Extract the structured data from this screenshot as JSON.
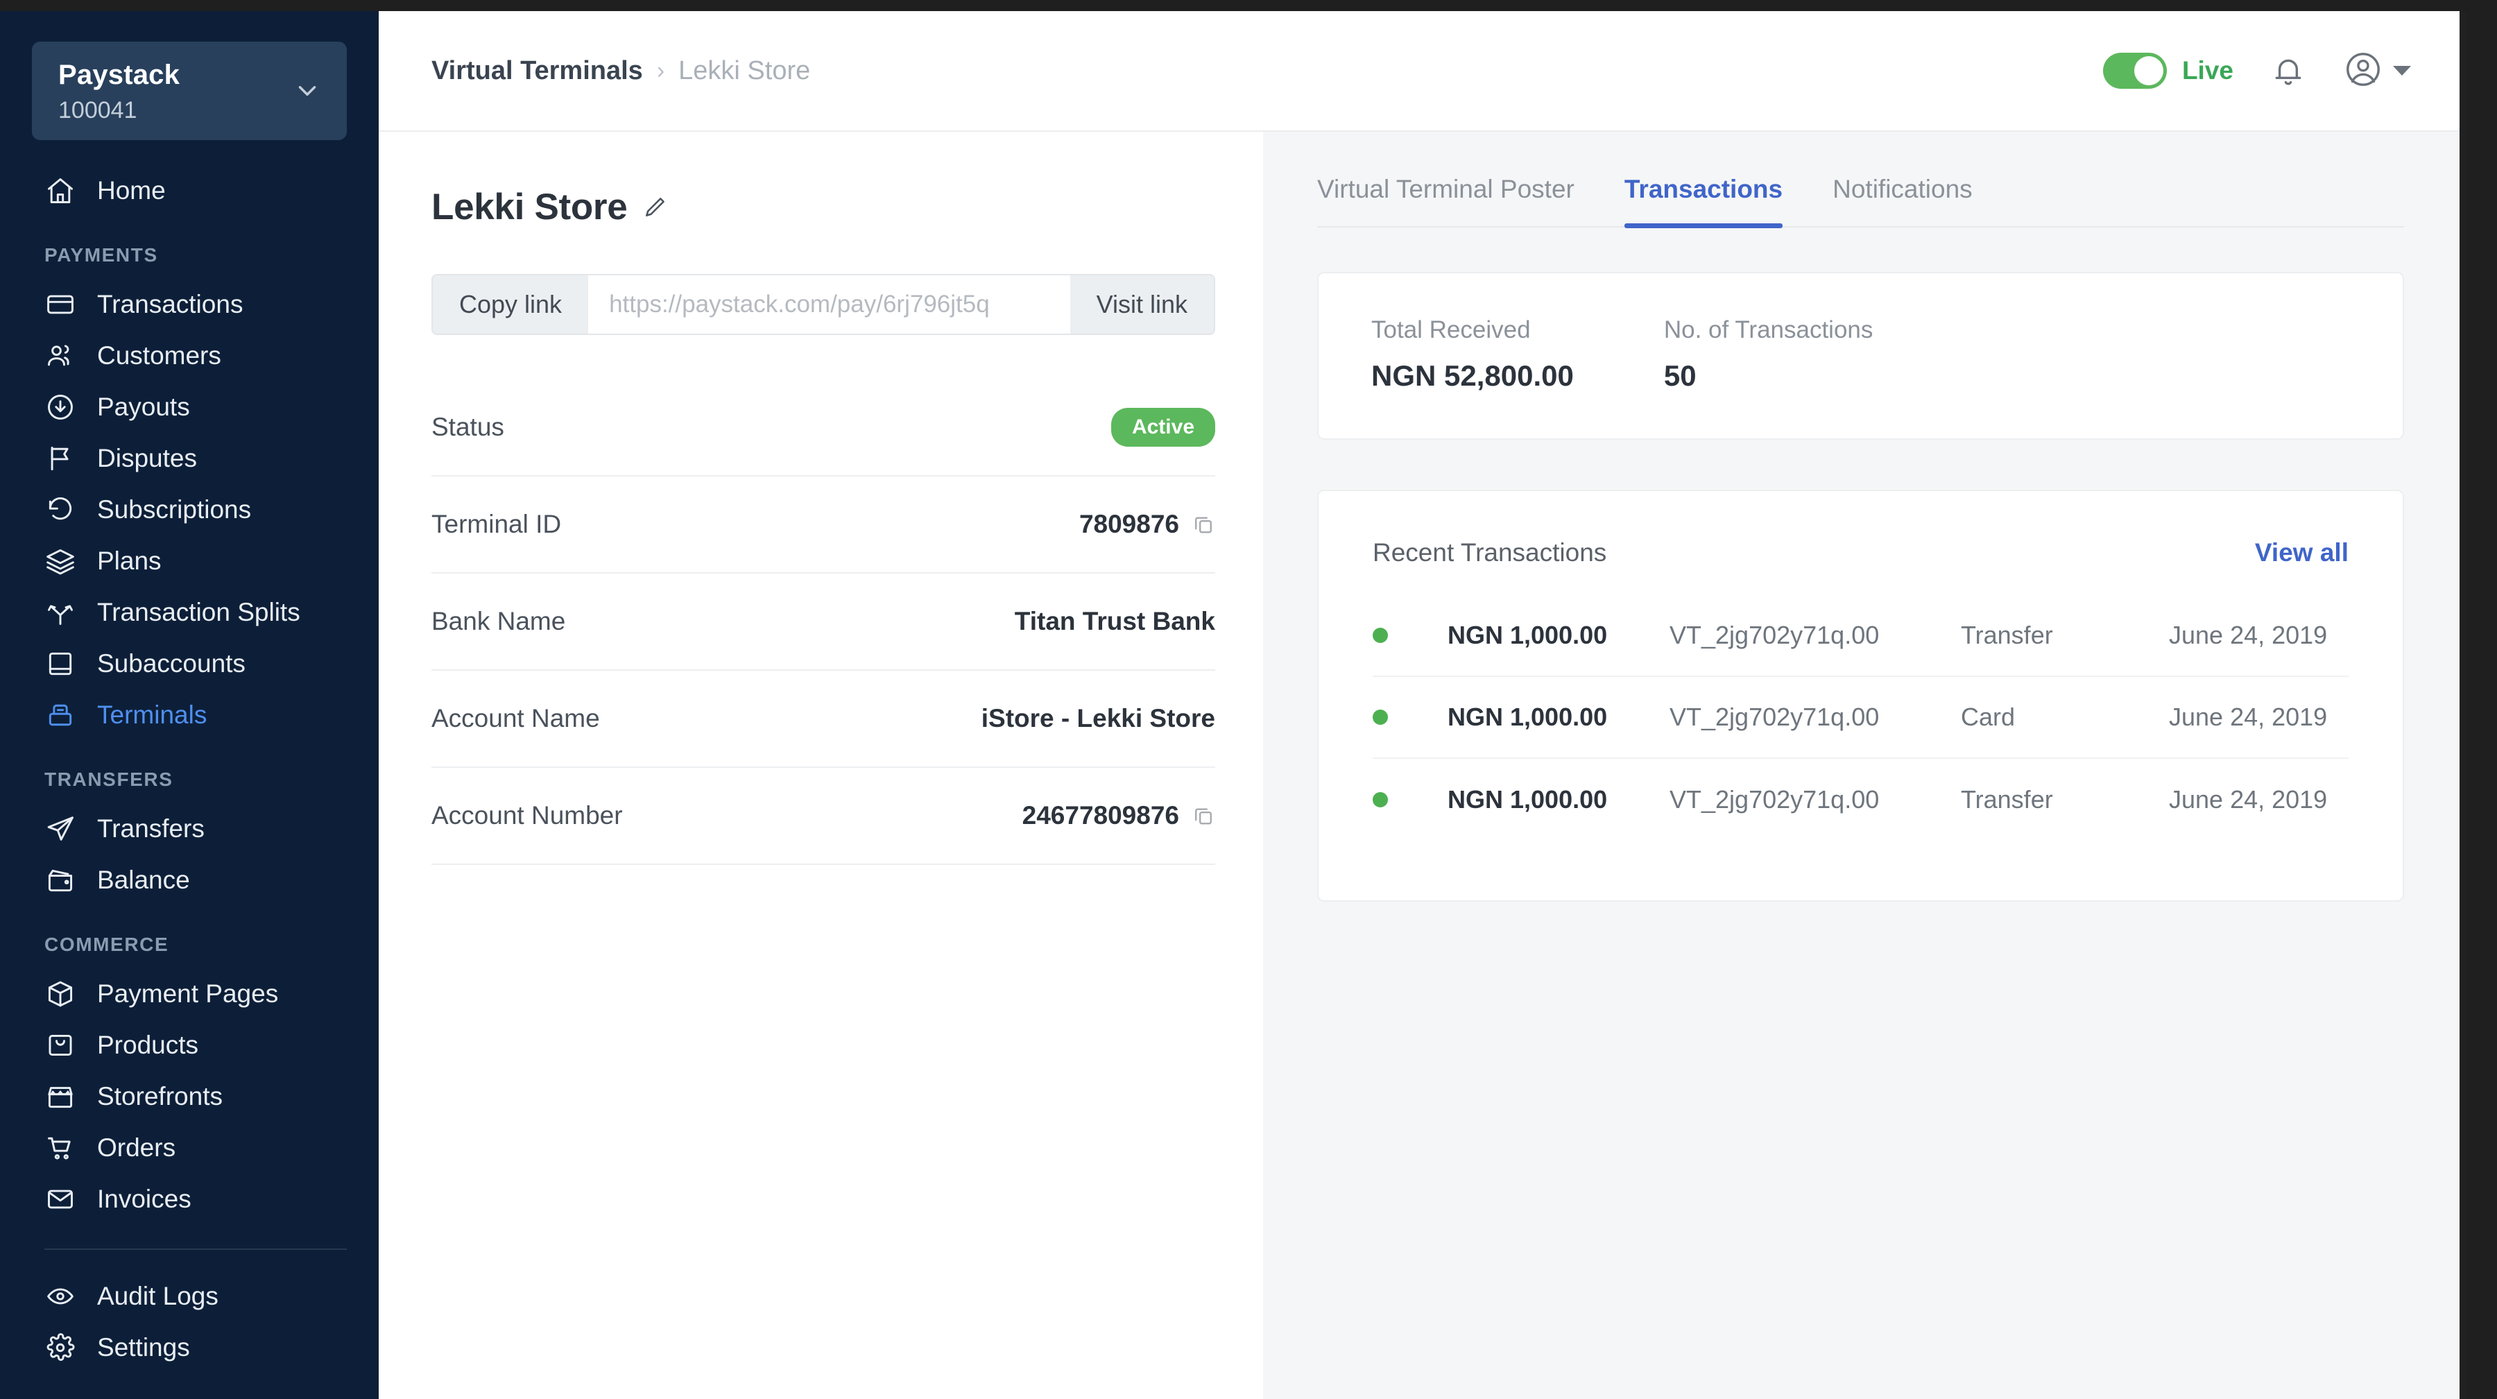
{
  "sidebar": {
    "account": {
      "name": "Paystack",
      "id": "100041"
    },
    "home": {
      "label": "Home"
    },
    "groups": [
      {
        "label": "PAYMENTS",
        "items": [
          {
            "label": "Transactions",
            "icon": "card-icon"
          },
          {
            "label": "Customers",
            "icon": "users-icon"
          },
          {
            "label": "Payouts",
            "icon": "download-circle-icon"
          },
          {
            "label": "Disputes",
            "icon": "flag-icon"
          },
          {
            "label": "Subscriptions",
            "icon": "refresh-icon"
          },
          {
            "label": "Plans",
            "icon": "layers-icon"
          },
          {
            "label": "Transaction Splits",
            "icon": "split-icon"
          },
          {
            "label": "Subaccounts",
            "icon": "inbox-icon"
          },
          {
            "label": "Terminals",
            "icon": "terminal-icon",
            "active": true
          }
        ]
      },
      {
        "label": "TRANSFERS",
        "items": [
          {
            "label": "Transfers",
            "icon": "send-icon"
          },
          {
            "label": "Balance",
            "icon": "wallet-icon"
          }
        ]
      },
      {
        "label": "COMMERCE",
        "items": [
          {
            "label": "Payment Pages",
            "icon": "box-icon"
          },
          {
            "label": "Products",
            "icon": "product-icon"
          },
          {
            "label": "Storefronts",
            "icon": "store-icon"
          },
          {
            "label": "Orders",
            "icon": "cart-icon"
          },
          {
            "label": "Invoices",
            "icon": "envelope-icon"
          }
        ]
      }
    ],
    "bottom_items": [
      {
        "label": "Audit Logs",
        "icon": "eye-icon"
      },
      {
        "label": "Settings",
        "icon": "gear-icon"
      }
    ]
  },
  "topbar": {
    "breadcrumb_root": "Virtual Terminals",
    "breadcrumb_separator": "›",
    "breadcrumb_current": "Lekki Store",
    "mode_toggle_label": "Live",
    "mode_toggle_on": true,
    "bell_icon": "bell-icon",
    "avatar_icon": "user-avatar-icon"
  },
  "terminal": {
    "title": "Lekki Store",
    "edit_icon": "pencil-icon",
    "copy_link_label": "Copy link",
    "link_placeholder": "https://paystack.com/pay/6rj796jt5q",
    "visit_link_label": "Visit link",
    "details": [
      {
        "label": "Status",
        "value": "Active",
        "type": "badge"
      },
      {
        "label": "Terminal ID",
        "value": "7809876",
        "copyable": true
      },
      {
        "label": "Bank Name",
        "value": "Titan Trust Bank"
      },
      {
        "label": "Account Name",
        "value": "iStore  - Lekki Store"
      },
      {
        "label": "Account Number",
        "value": "24677809876",
        "copyable": true
      }
    ]
  },
  "right_panel": {
    "tabs": [
      {
        "label": "Virtual Terminal Poster",
        "active": false
      },
      {
        "label": "Transactions",
        "active": true
      },
      {
        "label": "Notifications",
        "active": false
      }
    ],
    "stats": [
      {
        "label": "Total Received",
        "value": "NGN 52,800.00"
      },
      {
        "label": "No. of Transactions",
        "value": "50"
      }
    ],
    "transactions_card": {
      "title": "Recent Transactions",
      "view_all_label": "View all",
      "rows": [
        {
          "status": "success",
          "amount": "NGN 1,000.00",
          "reference": "VT_2jg702y71q.00",
          "channel": "Transfer",
          "date": "June 24, 2019"
        },
        {
          "status": "success",
          "amount": "NGN 1,000.00",
          "reference": "VT_2jg702y71q.00",
          "channel": "Card",
          "date": "June 24, 2019"
        },
        {
          "status": "success",
          "amount": "NGN 1,000.00",
          "reference": "VT_2jg702y71q.00",
          "channel": "Transfer",
          "date": "June 24, 2019"
        }
      ]
    }
  },
  "colors": {
    "sidebar_bg": "#0d1f38",
    "accent_blue": "#4065c9",
    "active_nav": "#4f8ff0",
    "success_green": "#5cb85c",
    "panel_bg": "#f5f6f7"
  }
}
